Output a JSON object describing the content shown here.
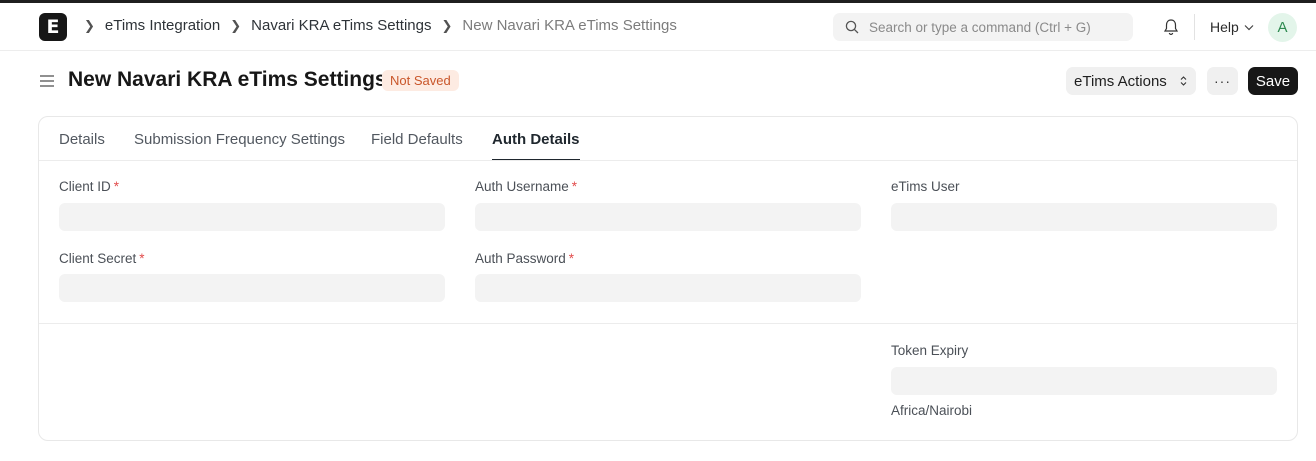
{
  "navbar": {
    "logo_letter": "E",
    "breadcrumbs": [
      "eTims Integration",
      "Navari KRA eTims Settings",
      "New Navari KRA eTims Settings"
    ],
    "search_placeholder": "Search or type a command (Ctrl + G)",
    "help_label": "Help",
    "avatar_letter": "A"
  },
  "page": {
    "title": "New Navari KRA eTims Settings",
    "status_badge": "Not Saved",
    "actions_label": "eTims Actions",
    "more_label": "···",
    "save_label": "Save"
  },
  "tabs": [
    "Details",
    "Submission Frequency Settings",
    "Field Defaults",
    "Auth Details"
  ],
  "active_tab": "Auth Details",
  "fields": {
    "client_id": {
      "label": "Client ID",
      "required": true,
      "value": ""
    },
    "auth_username": {
      "label": "Auth Username",
      "required": true,
      "value": ""
    },
    "etims_user": {
      "label": "eTims User",
      "required": false,
      "value": ""
    },
    "client_secret": {
      "label": "Client Secret",
      "required": true,
      "value": ""
    },
    "auth_password": {
      "label": "Auth Password",
      "required": true,
      "value": ""
    },
    "token_expiry": {
      "label": "Token Expiry",
      "required": false,
      "value": "",
      "timezone": "Africa/Nairobi"
    }
  },
  "required_marker": "*",
  "colors": {
    "accent": "#171717",
    "badge_bg": "#fdebe2",
    "badge_text": "#c9562a",
    "required": "#e24c4c"
  }
}
